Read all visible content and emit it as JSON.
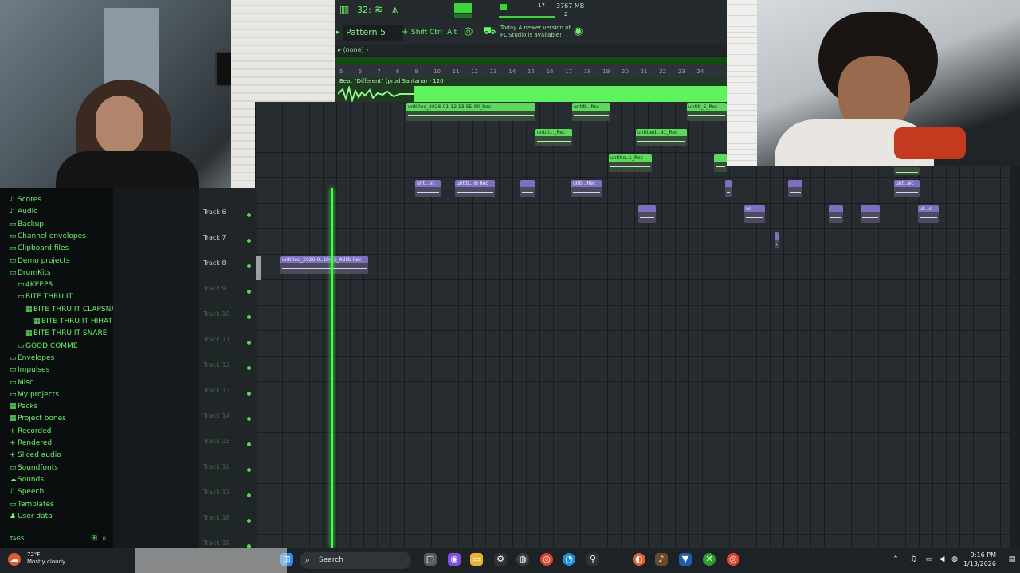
{
  "toolbar": {
    "tempo_label": "32:",
    "cpu_value": "17",
    "memory": "3767 MB",
    "voices": "2",
    "pattern_label": "Pattern 5",
    "shift_label": "Shift",
    "ctrl_label": "Ctrl",
    "alt_label": "Alt",
    "update_message": "Today  A newer version of FL Studio is available!",
    "breadcrumb": "(none)"
  },
  "ruler": {
    "numbers": [
      "5",
      "6",
      "7",
      "8",
      "9",
      "10",
      "11",
      "12",
      "13",
      "14",
      "15",
      "16",
      "17",
      "18",
      "19",
      "20",
      "21",
      "22",
      "23",
      "24"
    ]
  },
  "audio_track": {
    "label": "Beat \"Different\" (prod Santana) - 120"
  },
  "clips": {
    "c1": "untitled_2026-01-12 13-55-00_Rec",
    "c2": "untitl...Rec",
    "c3": "untitl_5_Rec",
    "c4": "untitl..._Rec",
    "c5": "untitled...41_Rec",
    "c6": "untitle..1_Rec",
    "c7": "unt...ec",
    "c8": "untitl...ib Rec",
    "c9": "unti...Rec",
    "c10": "unt...ec",
    "c11": "untitled_2026-0..10-11_Adlib Rec",
    "c12": "un",
    "c13": "ut...c"
  },
  "tracks": [
    {
      "name": "Track 6",
      "dim": false
    },
    {
      "name": "Track 7",
      "dim": false
    },
    {
      "name": "Track 8",
      "dim": false
    },
    {
      "name": "Track 9",
      "dim": true
    },
    {
      "name": "Track 10",
      "dim": true
    },
    {
      "name": "Track 11",
      "dim": true
    },
    {
      "name": "Track 12",
      "dim": true
    },
    {
      "name": "Track 13",
      "dim": true
    },
    {
      "name": "Track 14",
      "dim": true
    },
    {
      "name": "Track 15",
      "dim": true
    },
    {
      "name": "Track 16",
      "dim": true
    },
    {
      "name": "Track 17",
      "dim": true
    },
    {
      "name": "Track 18",
      "dim": true
    },
    {
      "name": "Track 19",
      "dim": true
    }
  ],
  "browser": {
    "items": [
      {
        "label": "Scores",
        "icon": "♪",
        "indent": 0
      },
      {
        "label": "Audio",
        "icon": "♪",
        "indent": 0
      },
      {
        "label": "Backup",
        "icon": "▭",
        "indent": 0
      },
      {
        "label": "Channel envelopes",
        "icon": "▭",
        "indent": 0
      },
      {
        "label": "Clipboard files",
        "icon": "▭",
        "indent": 0
      },
      {
        "label": "Demo projects",
        "icon": "▭",
        "indent": 0
      },
      {
        "label": "DrumKits",
        "icon": "▭",
        "indent": 0
      },
      {
        "label": "4KEEPS",
        "icon": "▭",
        "indent": 1
      },
      {
        "label": "BITE THRU IT",
        "icon": "▭",
        "indent": 1
      },
      {
        "label": "BITE THRU IT CLAPSNARE",
        "icon": "▦",
        "indent": 2
      },
      {
        "label": "BITE THRU IT HIHAT",
        "icon": "▦",
        "indent": 3
      },
      {
        "label": "BITE THRU IT SNARE",
        "icon": "▦",
        "indent": 2
      },
      {
        "label": "GOOD COMME",
        "icon": "▭",
        "indent": 1
      },
      {
        "label": "Envelopes",
        "icon": "▭",
        "indent": 0
      },
      {
        "label": "Impulses",
        "icon": "▭",
        "indent": 0
      },
      {
        "label": "Misc",
        "icon": "▭",
        "indent": 0
      },
      {
        "label": "My projects",
        "icon": "▭",
        "indent": 0
      },
      {
        "label": "Packs",
        "icon": "▦",
        "indent": 0
      },
      {
        "label": "Project bones",
        "icon": "▦",
        "indent": 0
      },
      {
        "label": "Recorded",
        "icon": "+",
        "indent": 0
      },
      {
        "label": "Rendered",
        "icon": "+",
        "indent": 0
      },
      {
        "label": "Sliced audio",
        "icon": "+",
        "indent": 0
      },
      {
        "label": "Soundfonts",
        "icon": "▭",
        "indent": 0
      },
      {
        "label": "Sounds",
        "icon": "☁",
        "indent": 0
      },
      {
        "label": "Speech",
        "icon": "♪",
        "indent": 0
      },
      {
        "label": "Templates",
        "icon": "▭",
        "indent": 0
      },
      {
        "label": "User data",
        "icon": "♟",
        "indent": 0
      }
    ],
    "tags_label": "TAGS"
  },
  "taskbar": {
    "temperature": "72°F",
    "weather": "Mostly cloudy",
    "search_label": "Search",
    "time": "9:16 PM",
    "date": "1/13/2026"
  },
  "colors": {
    "accent": "#5cda5c",
    "clip_green": "#5cda5c",
    "clip_purple": "#7f6fbf"
  }
}
